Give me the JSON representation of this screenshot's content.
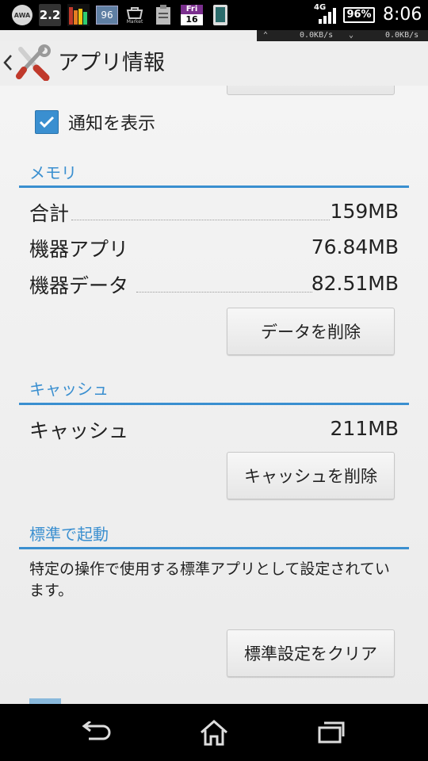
{
  "status_bar": {
    "notif_icons": {
      "awa": "AWA",
      "version": "2.2",
      "temp": "96",
      "market": "Market",
      "calendar_day": "Fri",
      "calendar_date": "16"
    },
    "network": "4G",
    "battery": "96%",
    "time": "8:06"
  },
  "net_speed": {
    "up": "0.0KB/s",
    "down": "0.0KB/s"
  },
  "action_bar": {
    "title": "アプリ情報"
  },
  "notifications": {
    "label": "通知を表示",
    "checked": true
  },
  "memory": {
    "title": "メモリ",
    "rows": [
      {
        "label": "合計",
        "value": "159MB"
      },
      {
        "label": "機器アプリ",
        "value": "76.84MB"
      },
      {
        "label": "機器データ",
        "value": "82.51MB"
      }
    ],
    "clear_data_button": "データを削除"
  },
  "cache": {
    "title": "キャッシュ",
    "row": {
      "label": "キャッシュ",
      "value": "211MB"
    },
    "clear_cache_button": "キャッシュを削除"
  },
  "defaults": {
    "title": "標準で起動",
    "description": "特定の操作で使用する標準アプリとして設定されています。",
    "clear_defaults_button": "標準設定をクリア"
  },
  "colors": {
    "accent": "#3a8fd0"
  }
}
